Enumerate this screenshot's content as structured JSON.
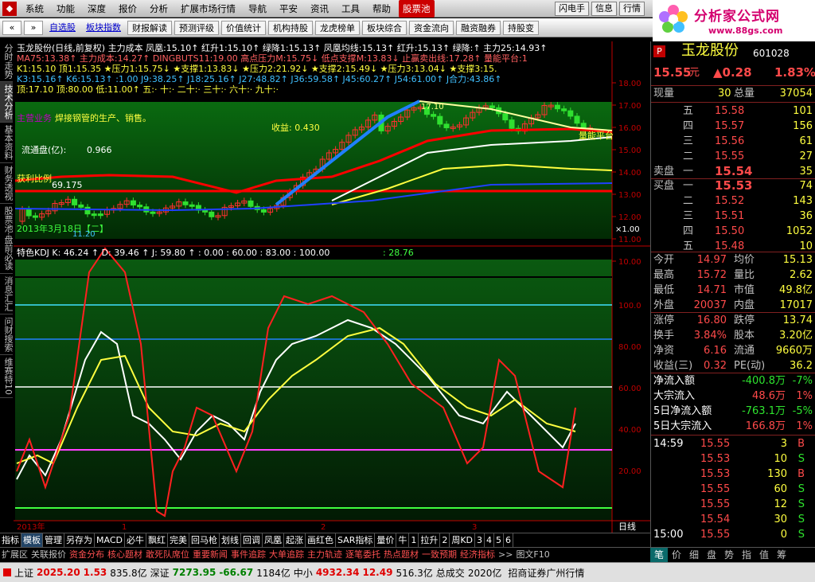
{
  "menubar": {
    "items": [
      "系统",
      "功能",
      "深度",
      "报价",
      "分析",
      "扩展市场行情",
      "导航",
      "平安",
      "资讯",
      "工具",
      "帮助"
    ],
    "active": "股票池",
    "right": [
      "闪电手",
      "信息",
      "行情"
    ]
  },
  "brand": {
    "title": "分析家公式网",
    "url": "www.88gs.com"
  },
  "toolbar": {
    "links": [
      "自选股",
      "板块指数"
    ],
    "buttons": [
      "财报解读",
      "预测评级",
      "价值统计",
      "机构持股",
      "龙虎榜单",
      "板块综合",
      "资金流向",
      "融资融券",
      "持股变"
    ]
  },
  "leftbar": [
    "分时走势",
    "技术分析",
    "基本资料",
    "财务透视",
    "股票池·盘前必读",
    "消息汇汇",
    "问财搜索",
    "维赛特10"
  ],
  "chart": {
    "info1": "玉龙股份(日线,前复权) 主力成本  凤凰:15.10↑ 红升1:15.10↑ 绿降1:15.13↑ 凤凰均线:15.13↑ 红升:15.13↑ 绿降:↑ 主力25:14.93↑",
    "info2": "MA75:13.38↑ 主力成本:14.27↑ DINGBUTS11:19.00 高点压力M:15.75↓ 低点支撑M:13.83↓ 止赢卖出线:17.28↑ 量能平台:1",
    "info3": "K1:15.10 顶1:15.35   ★压力1:15.75↓ ★支撑1:13.83↓ ★压力2:21.92↓ ★支撑2:15.49↓ ★压力3:13.04↓ ★支撑3:15.",
    "info4": "K3:15.16↑ K6:15.13↑ :1.00 J9:38.25↑ J18:25.16↑ J27:48.82↑ J36:59.58↑ J45:60.27↑ J54:61.00↑ J合力:43.86↑",
    "info5": "顶:17.10 顶:80.00 低:11.00↑   五:· 十:· 二十:· 三十:· 六十:· 九十:·",
    "main_business": "主营业务",
    "business": "焊接钢管的生产、销售。",
    "income": "收益: 0.430",
    "float": "流通盘(亿):",
    "float_val": "0.966",
    "profit": "获利比例",
    "profit_val": "69.175",
    "date_label": "2013年3月18日【二】",
    "low_label": "11.20",
    "peak_label": "17.10",
    "platform_label": "量能平台",
    "kdj_info": "特色KDJ  K: 46.24 ↑  D: 39.46 ↑  J: 59.80 ↑  : 0.00  : 60.00  : 83.00  : 100.00",
    "kdj_extra": ": 28.76",
    "price_ticks": [
      "18.00",
      "17.00",
      "16.00",
      "15.00",
      "14.00",
      "13.00",
      "12.00",
      "11.00",
      "10.00"
    ],
    "kdj_ticks": [
      "100.0",
      "80.00",
      "60.00",
      "40.00",
      "20.00"
    ],
    "x_ticks": [
      "2013年",
      "1",
      "2",
      "3"
    ],
    "period": "日线",
    "ylabel_unit": "×1.00"
  },
  "bottomtabs": [
    "指标",
    "模板",
    "管理",
    "另存为",
    "MACD",
    "必牛",
    "飘红",
    "完美",
    "回马枪",
    "划线",
    "回调",
    "凤凰",
    "起涨",
    "画红色",
    "SAR指标",
    "量价",
    "牛",
    "1",
    "拉升",
    "2",
    "周KD",
    "3",
    "4",
    "5",
    "6"
  ],
  "bottomtabs_sel": "模板",
  "featbar": [
    "扩展区",
    "关联报价",
    "资金分布",
    "核心题材",
    "敢死队席位",
    "重要新闻",
    "事件追踪",
    "大单追踪",
    "主力轨迹",
    "逐笔委托",
    "热点题材",
    "一致预期",
    "经济指标",
    ">>",
    "图文F10"
  ],
  "right": {
    "code_badge": "P",
    "name": "玉龙股份",
    "code": "601028",
    "price": "15.55",
    "unit": "元",
    "change": "▲0.28",
    "pct": "1.83%",
    "vol_now_label": "现量",
    "vol_now": "30",
    "vol_total_label": "总量",
    "vol_total": "37054",
    "sells": [
      {
        "l": "五",
        "p": "15.58",
        "v": "101"
      },
      {
        "l": "四",
        "p": "15.57",
        "v": "156"
      },
      {
        "l": "三",
        "p": "15.56",
        "v": "61"
      },
      {
        "l": "二",
        "p": "15.55",
        "v": "27"
      },
      {
        "l": "一",
        "p": "15.54",
        "v": "35"
      }
    ],
    "sell_label": "卖盘",
    "buy_label": "买盘",
    "buys": [
      {
        "l": "一",
        "p": "15.53",
        "v": "74"
      },
      {
        "l": "二",
        "p": "15.52",
        "v": "143"
      },
      {
        "l": "三",
        "p": "15.51",
        "v": "36"
      },
      {
        "l": "四",
        "p": "15.50",
        "v": "1052"
      },
      {
        "l": "五",
        "p": "15.48",
        "v": "10"
      }
    ],
    "stats": [
      [
        "今开",
        "14.97",
        "均价",
        "15.13"
      ],
      [
        "最高",
        "15.72",
        "量比",
        "2.62"
      ],
      [
        "最低",
        "14.71",
        "市值",
        "49.8亿"
      ],
      [
        "外盘",
        "20037",
        "内盘",
        "17017"
      ],
      [
        "涨停",
        "16.80",
        "跌停",
        "13.74"
      ],
      [
        "换手",
        "3.84%",
        "股本",
        "3.20亿"
      ],
      [
        "净资",
        "6.16",
        "流通",
        "9660万"
      ],
      [
        "收益(三)",
        "0.32",
        "PE(动)",
        "36.2"
      ]
    ],
    "flows": [
      [
        "净流入额",
        "-400.8万",
        "-7%"
      ],
      [
        "大宗流入",
        "48.6万",
        "1%"
      ],
      [
        "5日净流入额",
        "-763.1万",
        "-5%"
      ],
      [
        "5日大宗流入",
        "166.8万",
        "1%"
      ]
    ],
    "ticks": [
      [
        "14:59",
        "15.55",
        "3",
        "B"
      ],
      [
        "",
        "15.53",
        "10",
        "S"
      ],
      [
        "",
        "15.53",
        "130",
        "B"
      ],
      [
        "",
        "15.55",
        "60",
        "S"
      ],
      [
        "",
        "15.55",
        "12",
        "S"
      ],
      [
        "",
        "15.54",
        "30",
        "S"
      ],
      [
        "15:00",
        "15.55",
        "0",
        "S"
      ]
    ],
    "tabs": [
      "笔",
      "价",
      "细",
      "盘",
      "势",
      "指",
      "值",
      "筹"
    ]
  },
  "status": {
    "sh_label": "上证",
    "sh": "2025.20",
    "sh_chg": "1.53",
    "sh_amt": "835.8亿",
    "sz_label": "深证",
    "sz": "7273.95",
    "sz_chg": "-66.67",
    "sz_amt": "1184亿",
    "zx_label": "中小",
    "zx": "4932.34",
    "zx_chg": "12.49",
    "zx_amt": "516.3亿",
    "total_label": "总成交",
    "total": "2020亿",
    "broker": "招商证券广州行情"
  }
}
